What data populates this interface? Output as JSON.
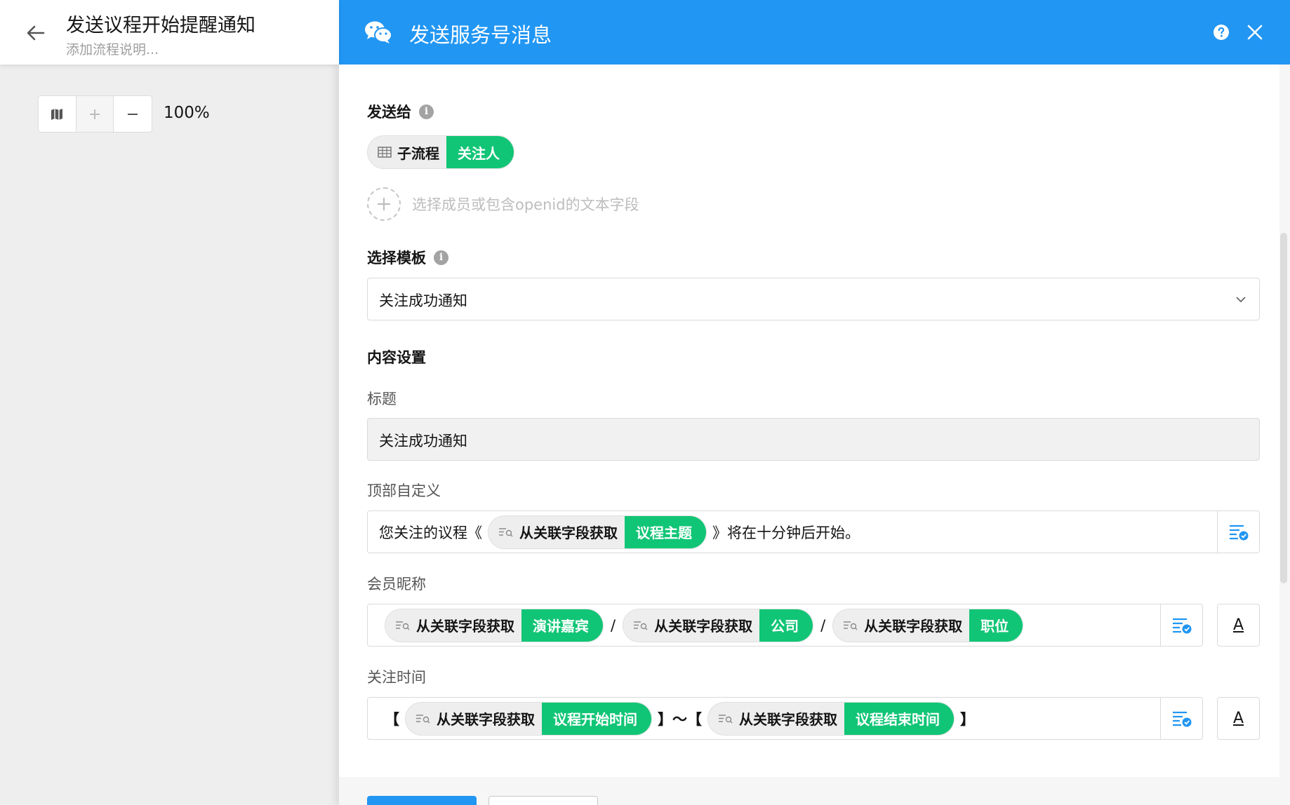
{
  "workflow": {
    "title": "发送议程开始提醒通知",
    "description_placeholder": "添加流程说明..."
  },
  "zoom": {
    "level": "100%"
  },
  "panel": {
    "title": "发送服务号消息",
    "header_color": "#2196f3",
    "send_to": {
      "label": "发送给",
      "recipients": [
        {
          "source": "子流程",
          "value": "关注人"
        }
      ],
      "add_hint": "选择成员或包含openid的文本字段"
    },
    "template": {
      "label": "选择模板",
      "selected": "关注成功通知"
    },
    "content": {
      "label": "内容设置",
      "title_field": {
        "label": "标题",
        "value": "关注成功通知"
      },
      "header_field": {
        "label": "顶部自定义",
        "prefix": "您关注的议程《",
        "token": {
          "source": "从关联字段获取",
          "value": "议程主题"
        },
        "suffix": "》将在十分钟后开始。"
      },
      "member_field": {
        "label": "会员昵称",
        "tokens": [
          {
            "source": "从关联字段获取",
            "value": "演讲嘉宾"
          },
          {
            "source": "从关联字段获取",
            "value": "公司"
          },
          {
            "source": "从关联字段获取",
            "value": "职位"
          }
        ],
        "separator": "/"
      },
      "time_field": {
        "label": "关注时间",
        "open_bracket": "【",
        "close_bracket": "】",
        "range_sep": "】～【",
        "start_token": {
          "source": "从关联字段获取",
          "value": "议程开始时间"
        },
        "end_token": {
          "source": "从关联字段获取",
          "value": "议程结束时间"
        }
      },
      "font_button_label": "A"
    }
  },
  "accent_green": "#11c576",
  "accent_blue": "#2196f3"
}
